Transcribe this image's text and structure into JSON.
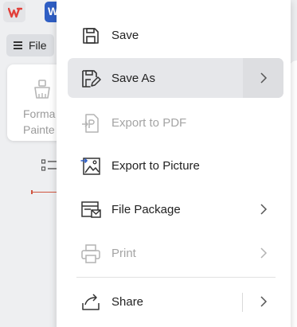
{
  "background": {
    "word_tab_letter": "W",
    "file_button_label": "File",
    "format_painter_label_line1": "Forma",
    "format_painter_label_line2": "Painte"
  },
  "menu": {
    "items": [
      {
        "label": "Save",
        "icon": "save-icon",
        "enabled": true,
        "submenu": false
      },
      {
        "label": "Save As",
        "icon": "save-as-icon",
        "enabled": true,
        "submenu": true
      },
      {
        "label": "Export to PDF",
        "icon": "export-pdf-icon",
        "enabled": false,
        "submenu": false
      },
      {
        "label": "Export to Picture",
        "icon": "export-picture-icon",
        "enabled": true,
        "submenu": false
      },
      {
        "label": "File Package",
        "icon": "file-package-icon",
        "enabled": true,
        "submenu": true
      },
      {
        "label": "Print",
        "icon": "print-icon",
        "enabled": false,
        "submenu": true
      },
      {
        "label": "Share",
        "icon": "share-icon",
        "enabled": true,
        "submenu": true
      }
    ]
  },
  "colors": {
    "accent_blue": "#2f5ec4",
    "wps_red": "#e2403a",
    "disabled_text": "#a4a4a4",
    "hover_bg": "#e6e7ea"
  }
}
